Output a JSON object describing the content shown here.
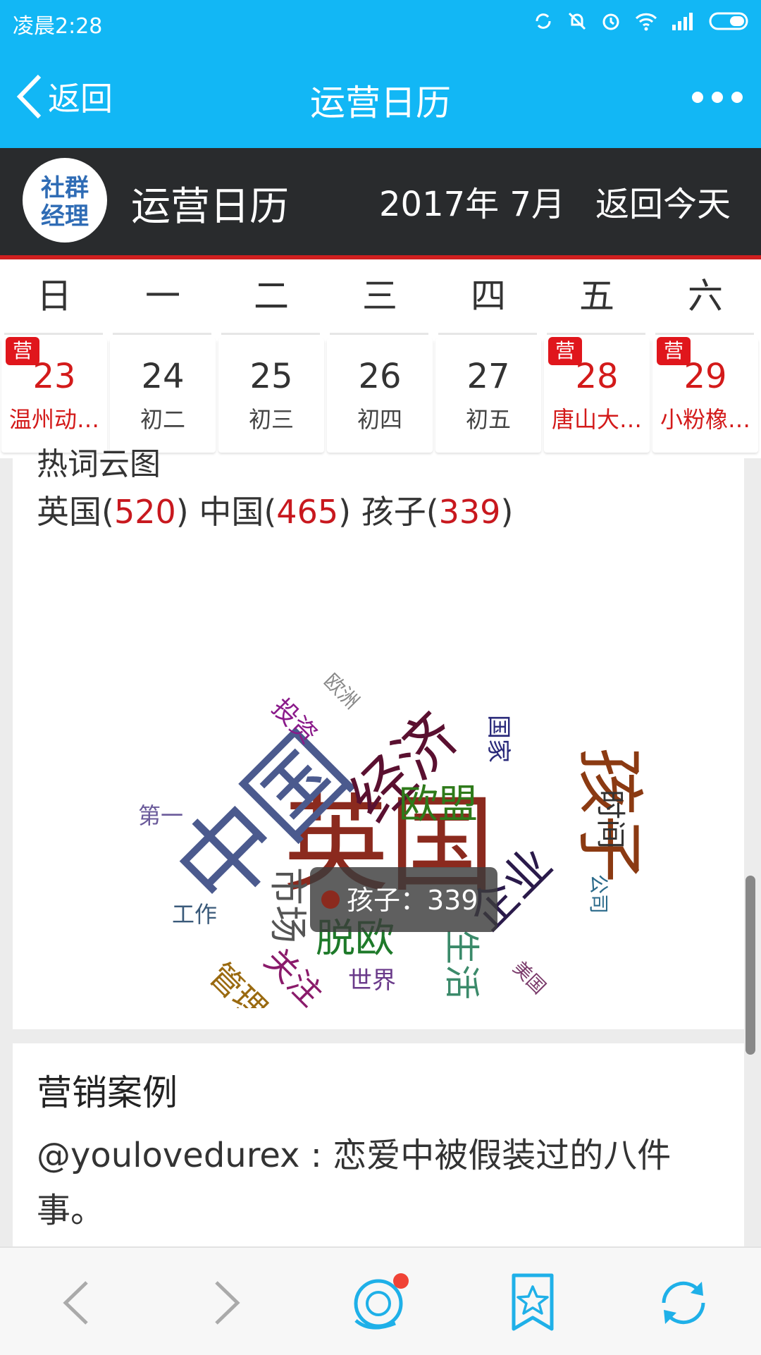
{
  "status_bar": {
    "time": "凌晨2:28"
  },
  "nav": {
    "back_label": "返回",
    "title": "运营日历"
  },
  "header": {
    "logo_text_line1": "社群",
    "logo_text_line2": "经理",
    "title": "运营日历",
    "month": "2017年 7月",
    "today_button": "返回今天"
  },
  "calendar": {
    "weekdays": [
      "日",
      "一",
      "二",
      "三",
      "四",
      "五",
      "六"
    ],
    "days": [
      {
        "num": "23",
        "sub": "温州动…",
        "badge": "营",
        "highlight": true
      },
      {
        "num": "24",
        "sub": "初二",
        "badge": "",
        "highlight": false
      },
      {
        "num": "25",
        "sub": "初三",
        "badge": "",
        "highlight": false
      },
      {
        "num": "26",
        "sub": "初四",
        "badge": "",
        "highlight": false
      },
      {
        "num": "27",
        "sub": "初五",
        "badge": "",
        "highlight": false
      },
      {
        "num": "28",
        "sub": "唐山大…",
        "badge": "营",
        "highlight": true
      },
      {
        "num": "29",
        "sub": "小粉橡…",
        "badge": "营",
        "highlight": true
      }
    ]
  },
  "hot_words": {
    "heading": "热词云图",
    "items": [
      {
        "word": "英国",
        "count": "520"
      },
      {
        "word": "中国",
        "count": "465"
      },
      {
        "word": "孩子",
        "count": "339"
      }
    ]
  },
  "wordcloud": {
    "tooltip": "孩子：339",
    "words": [
      {
        "text": "英国",
        "color": "#8b2a1e"
      },
      {
        "text": "中国",
        "color": "#4b5a8e"
      },
      {
        "text": "孩子",
        "color": "#8b3a12"
      },
      {
        "text": "经济",
        "color": "#5a1030"
      },
      {
        "text": "欧盟",
        "color": "#2e7a1a"
      },
      {
        "text": "企业",
        "color": "#2a1a4a"
      },
      {
        "text": "市场",
        "color": "#555555"
      },
      {
        "text": "脱欧",
        "color": "#1e7a2a"
      },
      {
        "text": "生活",
        "color": "#3b8a6a"
      },
      {
        "text": "关注",
        "color": "#8a1a6a"
      },
      {
        "text": "管理",
        "color": "#9a6a10"
      },
      {
        "text": "时间",
        "color": "#333333"
      },
      {
        "text": "投资",
        "color": "#8a1a8a"
      },
      {
        "text": "国家",
        "color": "#2a2a7a"
      },
      {
        "text": "欧洲",
        "color": "#888888"
      },
      {
        "text": "第一",
        "color": "#6a5a9a"
      },
      {
        "text": "工作",
        "color": "#3a5a7a"
      },
      {
        "text": "世界",
        "color": "#6a3a8a"
      },
      {
        "text": "公司",
        "color": "#2a6a8a"
      },
      {
        "text": "美国",
        "color": "#7a3a6a"
      }
    ]
  },
  "marketing_case": {
    "title": "营销案例",
    "text": "@youlovedurex : 恋爱中被假装过的八件事。"
  }
}
